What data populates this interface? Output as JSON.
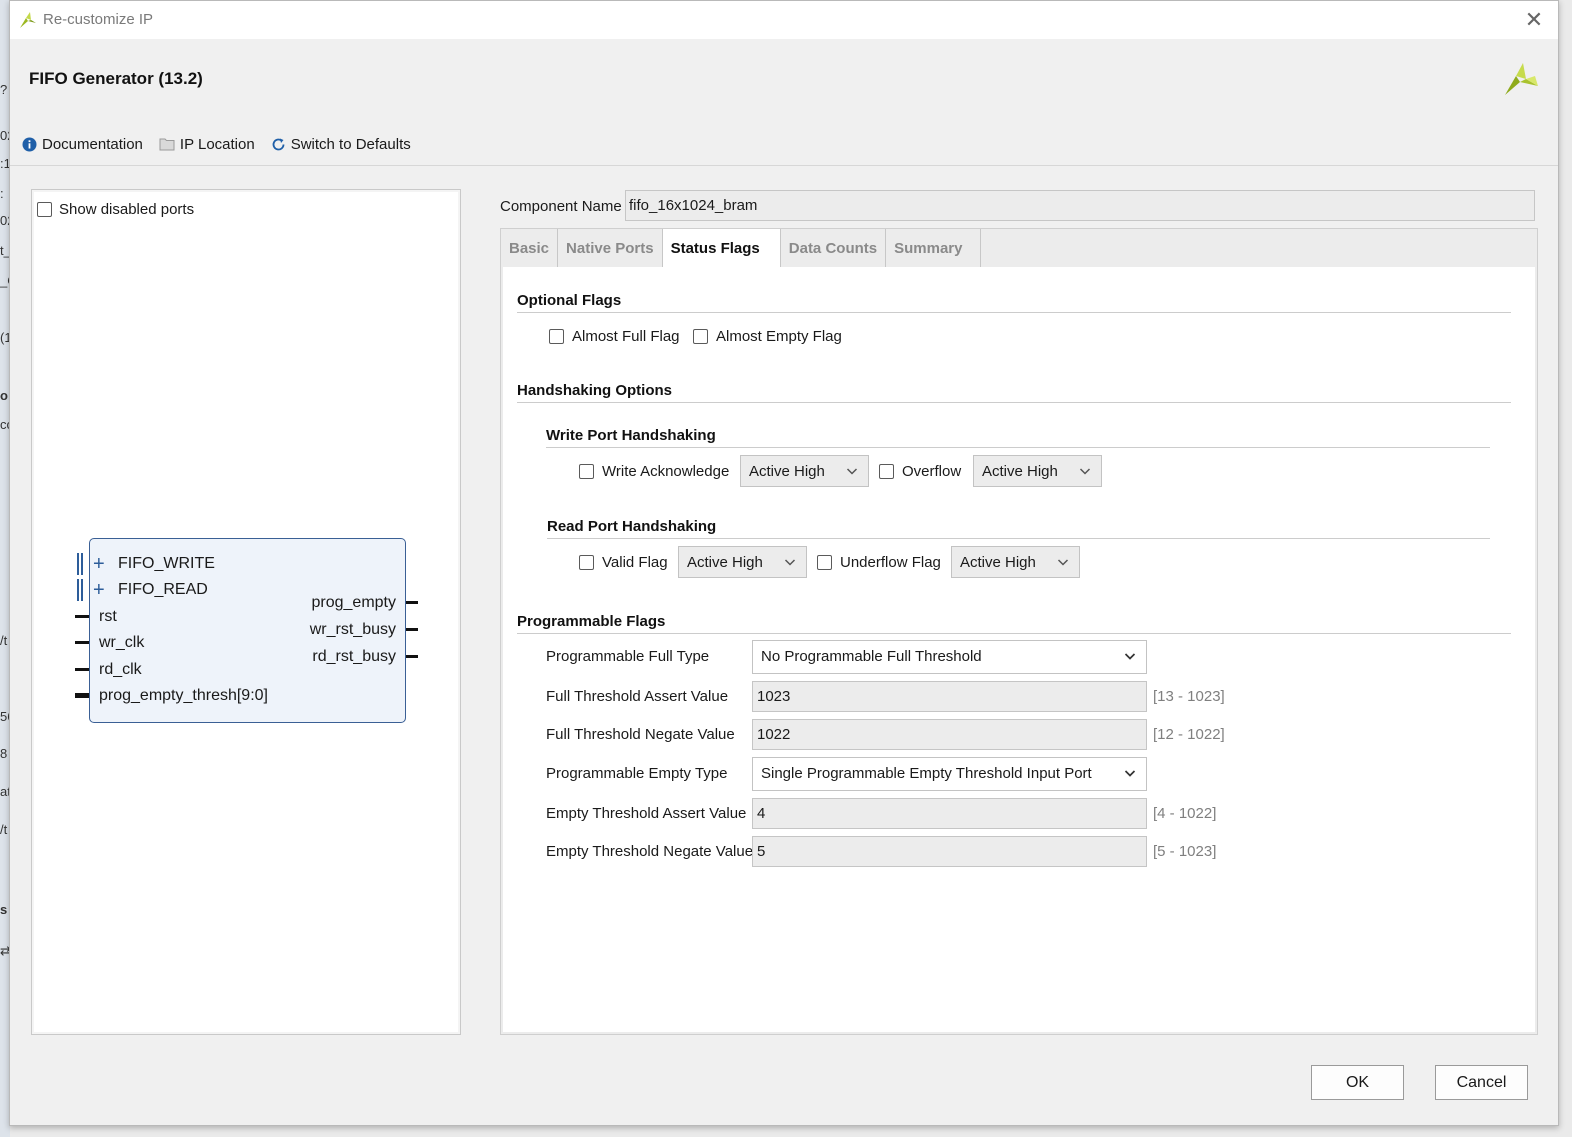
{
  "window": {
    "title": "Re-customize IP"
  },
  "header": {
    "ip_name": "FIFO Generator (13.2)"
  },
  "toolbar": {
    "documentation": "Documentation",
    "ip_location": "IP Location",
    "switch_defaults": "Switch to Defaults"
  },
  "symbol_panel": {
    "show_disabled_ports": "Show disabled ports",
    "bus_ports": [
      "FIFO_WRITE",
      "FIFO_READ"
    ],
    "inputs": [
      "rst",
      "wr_clk",
      "rd_clk",
      "prog_empty_thresh[9:0]"
    ],
    "outputs": [
      "prog_empty",
      "wr_rst_busy",
      "rd_rst_busy"
    ]
  },
  "component": {
    "label": "Component Name",
    "value": "fifo_16x1024_bram"
  },
  "tabs": [
    "Basic",
    "Native Ports",
    "Status Flags",
    "Data Counts",
    "Summary"
  ],
  "status_flags": {
    "optional_flags_title": "Optional Flags",
    "almost_full": "Almost Full Flag",
    "almost_empty": "Almost Empty Flag",
    "handshaking_title": "Handshaking Options",
    "write_port_title": "Write Port Handshaking",
    "write_ack": "Write Acknowledge",
    "write_ack_sense": "Active High",
    "overflow": "Overflow",
    "overflow_sense": "Active High",
    "read_port_title": "Read Port Handshaking",
    "valid_flag": "Valid Flag",
    "valid_sense": "Active High",
    "underflow": "Underflow Flag",
    "underflow_sense": "Active High",
    "programmable_title": "Programmable Flags",
    "prog_full_type_label": "Programmable Full Type",
    "prog_full_type_value": "No Programmable Full Threshold",
    "full_assert_label": "Full Threshold Assert Value",
    "full_assert_value": "1023",
    "full_assert_range": "[13 - 1023]",
    "full_negate_label": "Full Threshold Negate Value",
    "full_negate_value": "1022",
    "full_negate_range": "[12 - 1022]",
    "prog_empty_type_label": "Programmable Empty Type",
    "prog_empty_type_value": "Single Programmable Empty Threshold Input Port",
    "empty_assert_label": "Empty Threshold Assert Value",
    "empty_assert_value": "4",
    "empty_assert_range": "[4 - 1022]",
    "empty_negate_label": "Empty Threshold Negate Value",
    "empty_negate_value": "5",
    "empty_negate_range": "[5 - 1023]"
  },
  "buttons": {
    "ok": "OK",
    "cancel": "Cancel"
  },
  "background_fragments": [
    "?",
    "02",
    ":1",
    ":",
    "02",
    "t_",
    "_C",
    "(1",
    "o",
    "cc",
    "/t",
    "56",
    "8",
    "at",
    "/t",
    "s",
    "⇄"
  ],
  "colors": {
    "accent": "#2d5d9a",
    "xilinx_logo": "#9cb821",
    "info_icon": "#1f5fa8"
  }
}
